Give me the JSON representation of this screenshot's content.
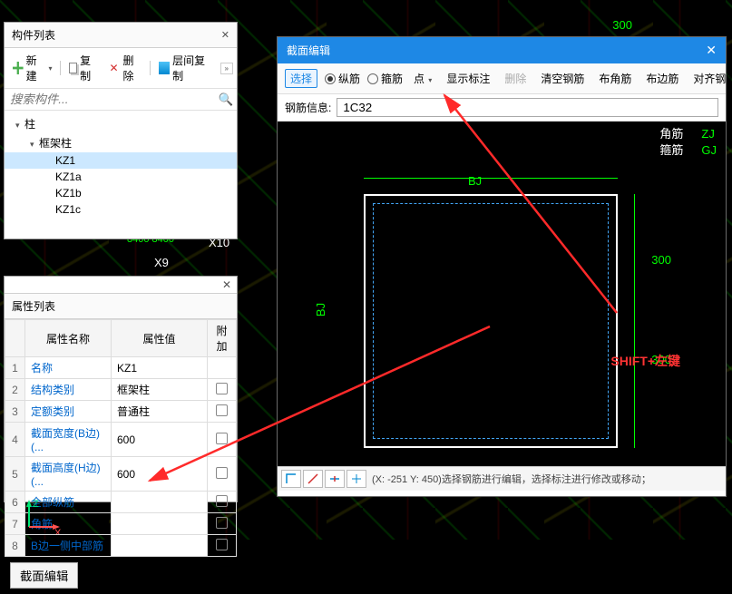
{
  "components_panel": {
    "title": "构件列表",
    "toolbar": {
      "new": "新建",
      "copy": "复制",
      "delete": "删除",
      "floor_copy": "层间复制"
    },
    "search_placeholder": "搜索构件...",
    "tree": {
      "root": "柱",
      "sub": "框架柱",
      "items": [
        "KZ1",
        "KZ1a",
        "KZ1b",
        "KZ1c"
      ],
      "selected_index": 0
    }
  },
  "props_panel": {
    "title": "属性列表",
    "headers": {
      "name": "属性名称",
      "value": "属性值",
      "extra": "附加"
    },
    "rows": [
      {
        "n": "1",
        "name": "名称",
        "value": "KZ1",
        "extra": ""
      },
      {
        "n": "2",
        "name": "结构类别",
        "value": "框架柱",
        "extra": "chk"
      },
      {
        "n": "3",
        "name": "定额类别",
        "value": "普通柱",
        "extra": "chk"
      },
      {
        "n": "4",
        "name": "截面宽度(B边)(...",
        "value": "600",
        "extra": "chk"
      },
      {
        "n": "5",
        "name": "截面高度(H边)(...",
        "value": "600",
        "extra": "chk"
      },
      {
        "n": "6",
        "name": "全部纵筋",
        "value": "",
        "extra": "chk"
      },
      {
        "n": "7",
        "name": "角筋",
        "value": "",
        "extra": "chk"
      },
      {
        "n": "8",
        "name": "B边一侧中部筋",
        "value": "",
        "extra": "chk"
      }
    ],
    "section_edit_btn": "截面编辑"
  },
  "editor": {
    "title": "截面编辑",
    "toolbar": {
      "select": "选择",
      "longitudinal": "纵筋",
      "stirrup": "箍筋",
      "point": "点",
      "show_label": "显示标注",
      "delete": "删除",
      "clear": "清空钢筋",
      "corner": "布角筋",
      "edge": "布边筋",
      "align": "对齐钢筋"
    },
    "rebar_info_label": "钢筋信息:",
    "rebar_info_value": "1C32",
    "legend": {
      "corner_cn": "角筋",
      "stirrup_cn": "箍筋",
      "zj": "ZJ",
      "gj": "GJ"
    },
    "bj_label": "BJ",
    "dim_300": "300",
    "shift_hint": "SHIFT+左键",
    "status": "(X: -251 Y: 450)选择钢筋进行编辑，选择标注进行修改或移动；"
  },
  "cad": {
    "dim1": "300",
    "x9": "X9",
    "x10": "X10",
    "d8400": "8400 8400",
    "axis_z": "Z",
    "axis_x": "X"
  }
}
